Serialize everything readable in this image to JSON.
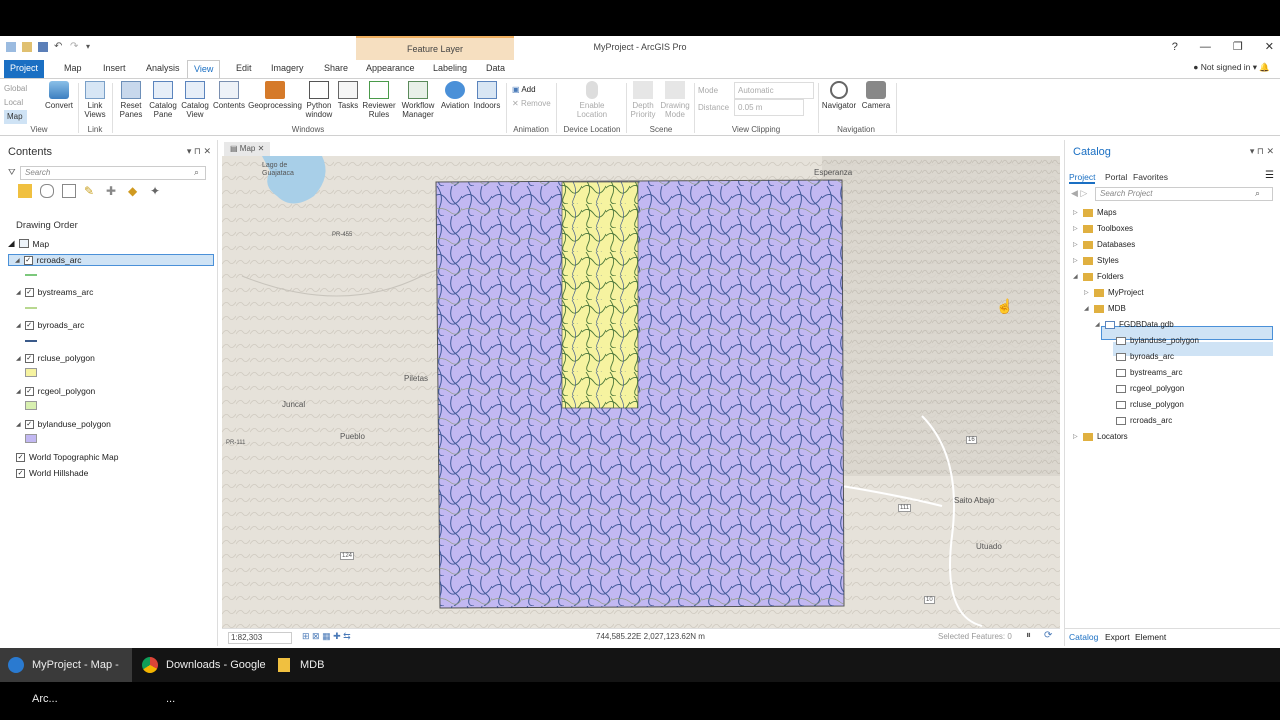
{
  "window": {
    "context_tab": "Feature Layer",
    "title": "MyProject - ArcGIS Pro",
    "controls": [
      "?",
      "—",
      "❐",
      "✕"
    ]
  },
  "tabs": [
    "Project",
    "Map",
    "Insert",
    "Analysis",
    "View",
    "Edit",
    "Imagery",
    "Share",
    "Appearance",
    "Labeling",
    "Data"
  ],
  "signin": "Not signed in",
  "ribbon": {
    "view_group": {
      "global": "Global",
      "local": "Local",
      "map": "Map",
      "convert": "Convert",
      "label": "View"
    },
    "link_group": {
      "link_views": "Link Views",
      "label": "Link"
    },
    "windows": {
      "reset_panes": "Reset Panes",
      "catalog_pane": "Catalog Pane",
      "catalog_view": "Catalog View",
      "contents": "Contents",
      "geoprocessing": "Geoprocessing",
      "python_window": "Python window",
      "tasks": "Tasks",
      "reviewer_rules": "Reviewer Rules",
      "workflow_manager": "Workflow Manager",
      "aviation": "Aviation",
      "indoors": "Indoors",
      "label": "Windows"
    },
    "animation": {
      "add": "Add",
      "remove": "Remove",
      "label": "Animation"
    },
    "device": {
      "enable_location": "Enable Location",
      "label": "Device Location"
    },
    "scene": {
      "depth_priority": "Depth Priority",
      "drawing_mode": "Drawing Mode",
      "label": "Scene"
    },
    "clipping": {
      "mode_label": "Mode",
      "mode_value": "Automatic",
      "distance_label": "Distance",
      "distance_value": "0.05 m",
      "label": "View Clipping"
    },
    "navigation": {
      "navigator": "Navigator",
      "camera": "Camera",
      "label": "Navigation"
    }
  },
  "contents": {
    "title": "Contents",
    "search_placeholder": "Search",
    "drawing_order": "Drawing Order",
    "map": "Map",
    "layers": [
      {
        "name": "rcroads_arc",
        "symbol": "line",
        "color": "#7cc87c"
      },
      {
        "name": "bystreams_arc",
        "symbol": "line",
        "color": "#b8d890"
      },
      {
        "name": "byroads_arc",
        "symbol": "line",
        "color": "#3a5a8a"
      },
      {
        "name": "rcluse_polygon",
        "symbol": "fill",
        "color": "#f6f3a0"
      },
      {
        "name": "rcgeol_polygon",
        "symbol": "fill",
        "color": "#d8f0b0"
      },
      {
        "name": "bylanduse_polygon",
        "symbol": "fill",
        "color": "#c2b8f2"
      },
      {
        "name": "World Topographic Map",
        "symbol": "none"
      },
      {
        "name": "World Hillshade",
        "symbol": "none"
      }
    ]
  },
  "map": {
    "tab": "Map",
    "labels": [
      "Lago de Guajataca",
      "Esperanza",
      "Piletas",
      "Juncal",
      "Pueblo",
      "Saito Abajo",
      "Utuado",
      "PR-455",
      "16",
      "111",
      "124",
      "10",
      "PR-111"
    ],
    "scale": "1:82,303",
    "coords": "744,585.22E 2,027,123.62N m",
    "selected": "Selected Features: 0"
  },
  "catalog": {
    "title": "Catalog",
    "tabs": [
      "Project",
      "Portal",
      "Favorites"
    ],
    "search_placeholder": "Search Project",
    "items": [
      "Maps",
      "Toolboxes",
      "Databases",
      "Styles",
      "Folders",
      "MyProject",
      "MDB",
      "FGDBData.gdb",
      "bylanduse_polygon",
      "byroads_arc",
      "bystreams_arc",
      "rcgeol_polygon",
      "rcluse_polygon",
      "rcroads_arc",
      "Locators"
    ],
    "bottom_tabs": [
      "Catalog",
      "Export",
      "Element"
    ]
  },
  "taskbar": {
    "items": [
      "MyProject - Map - Arc...",
      "Downloads - Google ...",
      "MDB"
    ]
  }
}
